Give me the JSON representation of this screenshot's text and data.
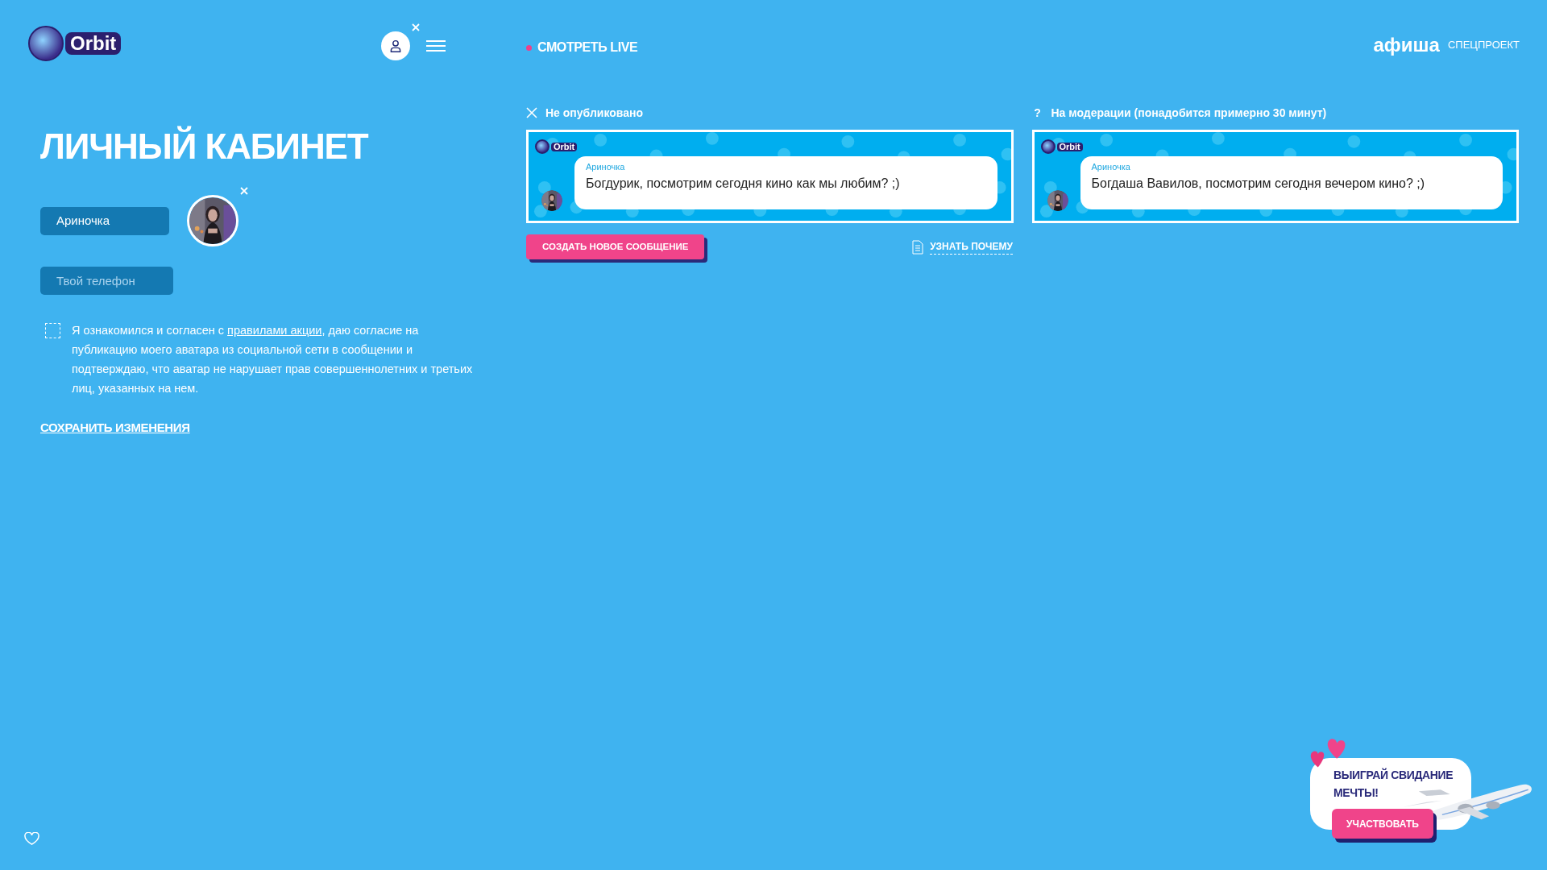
{
  "header": {
    "logo": "Orbit",
    "live_link": "СМОТРЕТЬ LIVE",
    "partner_logo": "афиша",
    "partner_label": "СПЕЦПРОЕКТ"
  },
  "profile": {
    "title": "ЛИЧНЫЙ КАБИНЕТ",
    "name_value": "Ариночка",
    "phone_placeholder": "Твой телефон",
    "consent": {
      "checked": false,
      "before": "Я ознакомился и согласен с ",
      "link": "правилами акции",
      "after": ", даю согласие на публикацию моего аватара из социальной сети в сообщении и подтверждаю, что аватар не нарушает прав совершеннолетних и третьих лиц, указанных на нем."
    },
    "save_link": "СОХРАНИТЬ ИЗМЕНЕНИЯ"
  },
  "messages": [
    {
      "status": {
        "kind": "rejected",
        "label": "Не опубликовано"
      },
      "logo": "Orbit",
      "author": "Ариночка",
      "text": "Богдурик, посмотрим сегодня кино как мы любим? ;)"
    },
    {
      "status": {
        "kind": "pending",
        "mark": "?",
        "label": "На модерации (понадобится примерно 30 минут)"
      },
      "logo": "Orbit",
      "author": "Ариночка",
      "text": "Богдаша Вавилов, посмотрим сегодня вечером кино? ;)"
    }
  ],
  "create_button": "СОЗДАТЬ НОВОЕ СООБЩЕНИЕ",
  "why_link": "УЗНАТЬ ПОЧЕМУ",
  "promo": {
    "title": "ВЫИГРАЙ СВИДАНИЕ МЕЧТЫ!",
    "button": "УЧАСТВОВАТЬ"
  }
}
